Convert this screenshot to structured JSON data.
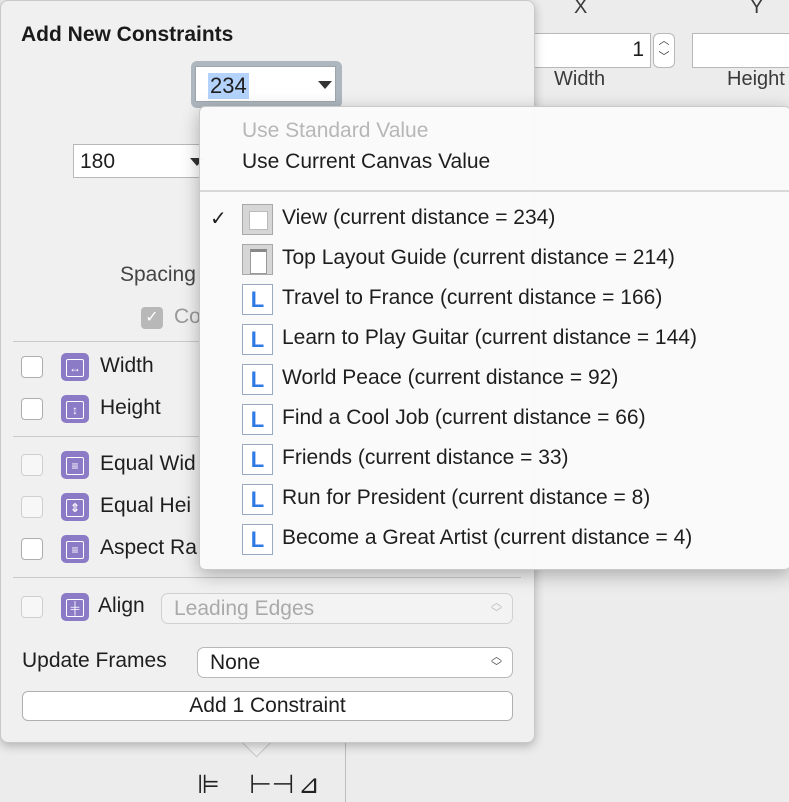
{
  "background_inspector": {
    "x_header": "X",
    "y_header": "Y",
    "x_value": "1",
    "width_label": "Width",
    "height_label": "Height"
  },
  "popover": {
    "title": "Add New Constraints",
    "top_distance_value": "234",
    "left_distance_value": "180",
    "spacing_label_partial": "Spacing",
    "constrain_label_partial": "Co",
    "rows": [
      {
        "label": "Width",
        "icon": "width-constraint-icon",
        "enabled": true
      },
      {
        "label": "Height",
        "icon": "height-constraint-icon",
        "enabled": true
      },
      {
        "label": "Equal Wid",
        "icon": "equal-widths-icon",
        "enabled": false
      },
      {
        "label": "Equal Hei",
        "icon": "equal-heights-icon",
        "enabled": false
      },
      {
        "label": "Aspect Ra",
        "icon": "aspect-ratio-icon",
        "enabled": true
      }
    ],
    "align_label": "Align",
    "align_value": "Leading Edges",
    "update_frames_label": "Update Frames",
    "update_frames_value": "None",
    "add_button_label": "Add 1 Constraint"
  },
  "menu": {
    "options": [
      {
        "label": "Use Standard Value",
        "enabled": false
      },
      {
        "label": "Use Current Canvas Value",
        "enabled": true
      }
    ],
    "items": [
      {
        "label": "View (current distance = 234)",
        "icon": "view-icon",
        "checked": true
      },
      {
        "label": "Top Layout Guide (current distance = 214)",
        "icon": "layout-guide-icon",
        "checked": false
      },
      {
        "label": "Travel to France (current distance = 166)",
        "icon": "label-icon",
        "checked": false
      },
      {
        "label": "Learn to Play Guitar (current distance = 144)",
        "icon": "label-icon",
        "checked": false
      },
      {
        "label": "World Peace (current distance = 92)",
        "icon": "label-icon",
        "checked": false
      },
      {
        "label": "Find a Cool Job (current distance = 66)",
        "icon": "label-icon",
        "checked": false
      },
      {
        "label": "Friends (current distance = 33)",
        "icon": "label-icon",
        "checked": false
      },
      {
        "label": "Run for President (current distance = 8)",
        "icon": "label-icon",
        "checked": false
      },
      {
        "label": "Become a Great Artist (current distance = 4)",
        "icon": "label-icon",
        "checked": false
      }
    ]
  },
  "toolbar": {
    "icons": [
      "align-icon",
      "pin-icon",
      "resolve-issues-icon"
    ]
  },
  "colors": {
    "constraint_icon": "#8b7bc6",
    "label_icon_text": "#2f7ae5",
    "selection_highlight": "#b3d3fd"
  }
}
